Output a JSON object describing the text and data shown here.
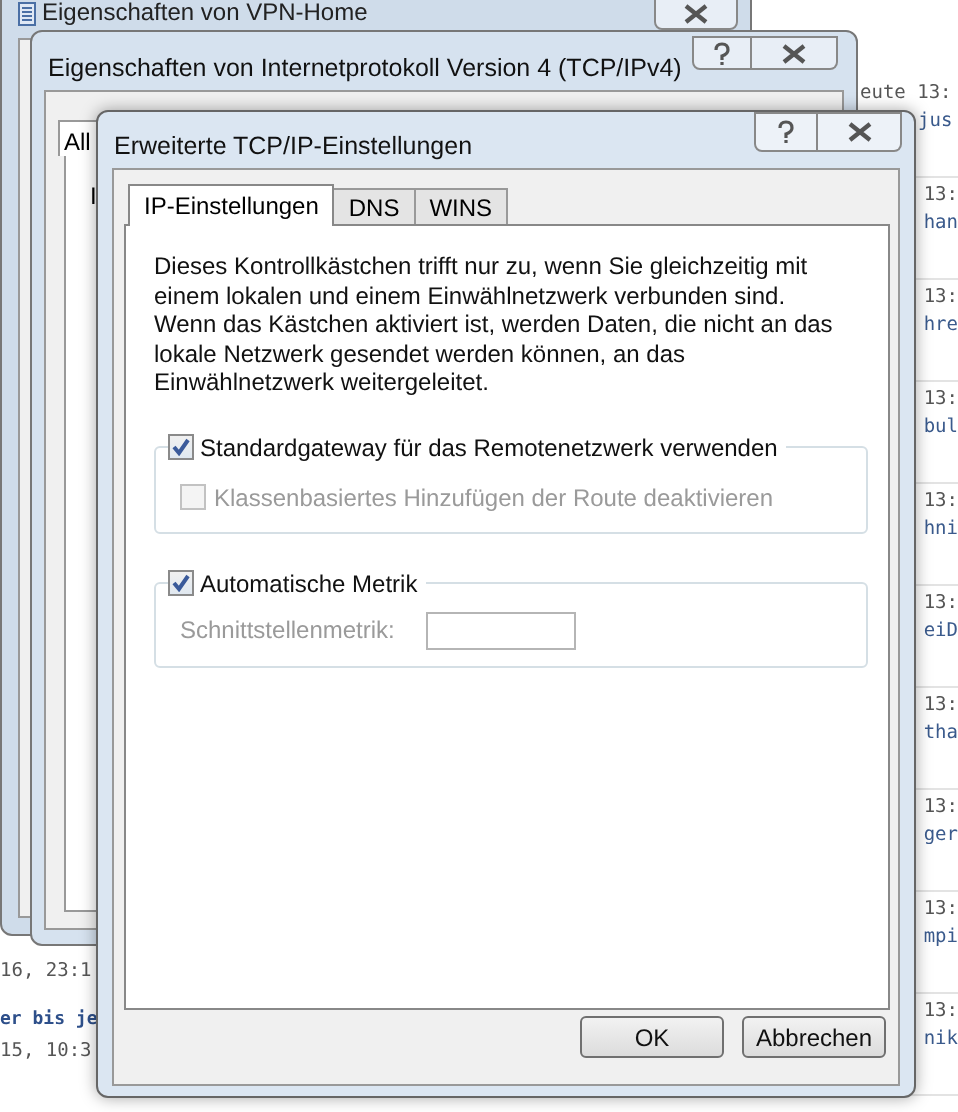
{
  "background_page": {
    "feed": [
      {
        "time": "eute 13:",
        "snippet": "jus"
      },
      {
        "time": "13:",
        "snippet": "han"
      },
      {
        "time": "13:",
        "snippet": "hre"
      },
      {
        "time": "13:",
        "snippet": "bul"
      },
      {
        "time": "13:",
        "snippet": "hni"
      },
      {
        "time": "13:",
        "snippet": "eiD"
      },
      {
        "time": "13:",
        "snippet": "tha"
      },
      {
        "time": "13:",
        "snippet": "ger"
      },
      {
        "time": "13:",
        "snippet": "mpi"
      },
      {
        "time": "13:",
        "snippet": "nik"
      }
    ],
    "left_fragments": [
      {
        "kind": "date",
        "text": "16, 23:1"
      },
      {
        "kind": "link",
        "text": "er bis je"
      },
      {
        "kind": "date",
        "text": "15, 10:3"
      }
    ]
  },
  "back_window": {
    "title": "Eigenschaften von VPN-Home"
  },
  "middle_window": {
    "title": "Eigenschaften von Internetprotokoll Version 4 (TCP/IPv4)",
    "tab": "All",
    "labels": [
      "I"
    ]
  },
  "dialog": {
    "title": "Erweiterte TCP/IP-Einstellungen",
    "tabs": [
      {
        "label": "IP-Einstellungen",
        "selected": true
      },
      {
        "label": "DNS",
        "selected": false
      },
      {
        "label": "WINS",
        "selected": false
      }
    ],
    "description": "Dieses Kontrollkästchen trifft nur zu, wenn Sie gleichzeitig mit einem lokalen und einem Einwählnetzwerk verbunden sind. Wenn das Kästchen aktiviert ist, werden Daten, die nicht an das lokale Netzwerk gesendet werden können, an das Einwählnetzwerk weitergeleitet.",
    "groups": [
      {
        "checkbox": {
          "label": "Standardgateway für das Remotenetzwerk verwenden",
          "checked": true,
          "disabled": false
        },
        "rows": [
          {
            "kind": "checkbox",
            "label": "Klassenbasiertes Hinzufügen der Route deaktivieren",
            "checked": false,
            "disabled": true
          }
        ]
      },
      {
        "checkbox": {
          "label": "Automatische Metrik",
          "checked": true,
          "disabled": false
        },
        "rows": [
          {
            "kind": "field",
            "label": "Schnittstellenmetrik:",
            "disabled": true
          }
        ]
      }
    ],
    "buttons": [
      "OK",
      "Abbrechen"
    ]
  }
}
